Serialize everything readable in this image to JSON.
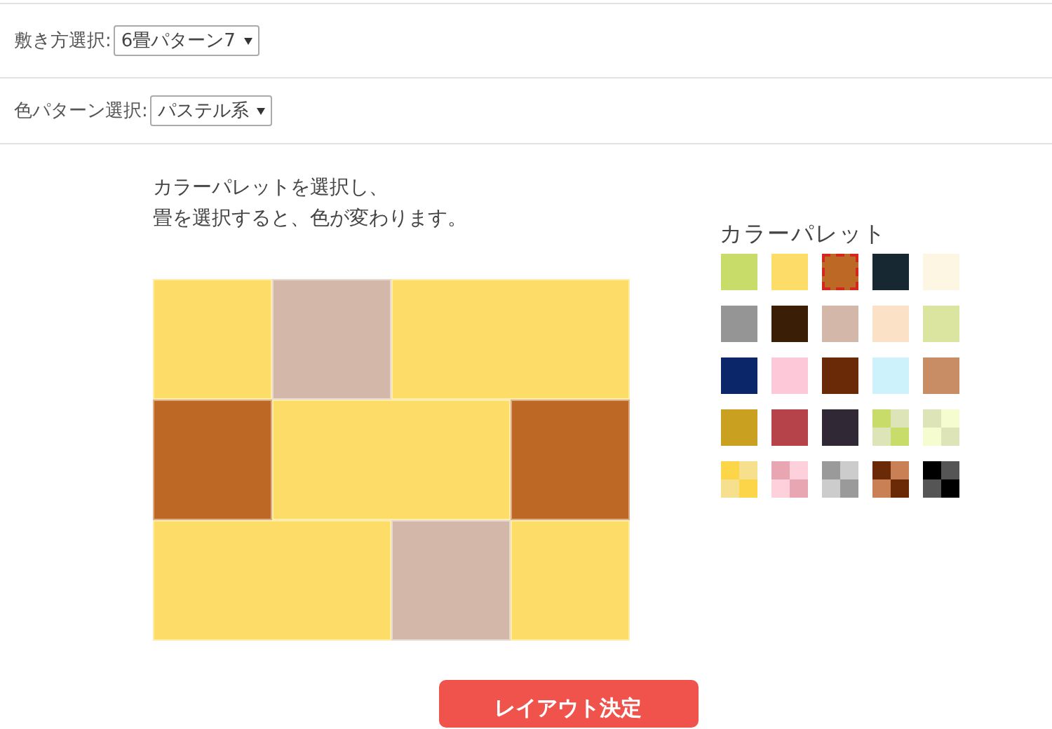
{
  "selectors": [
    {
      "label": "敷き方選択:",
      "value": "6畳パターン7"
    },
    {
      "label": "色パターン選択:",
      "value": "パステル系"
    }
  ],
  "instructions": [
    "カラーパレットを選択し、",
    "畳を選択すると、色が変わります。"
  ],
  "tatami_rows": [
    [
      {
        "kind": "half",
        "color": "#fddd67"
      },
      {
        "kind": "half",
        "color": "#d3b8aa"
      },
      {
        "kind": "full",
        "color": "#fddd67"
      }
    ],
    [
      {
        "kind": "half",
        "color": "#bd6925"
      },
      {
        "kind": "full",
        "color": "#fddd67"
      },
      {
        "kind": "half",
        "color": "#bd6925"
      }
    ],
    [
      {
        "kind": "full",
        "color": "#fddd67"
      },
      {
        "kind": "half",
        "color": "#d3b8aa"
      },
      {
        "kind": "half",
        "color": "#fddd67"
      }
    ]
  ],
  "palette": {
    "title": "カラーパレット",
    "swatches": [
      {
        "kind": "solid",
        "color": "#c8dc6a",
        "selected": false
      },
      {
        "kind": "solid",
        "color": "#fddd67",
        "selected": false
      },
      {
        "kind": "solid",
        "color": "#bd6925",
        "selected": true
      },
      {
        "kind": "solid",
        "color": "#182833",
        "selected": false
      },
      {
        "kind": "solid",
        "color": "#fdf6e3",
        "selected": false
      },
      {
        "kind": "solid",
        "color": "#959595",
        "selected": false
      },
      {
        "kind": "solid",
        "color": "#3a1e05",
        "selected": false
      },
      {
        "kind": "solid",
        "color": "#d3b8aa",
        "selected": false
      },
      {
        "kind": "solid",
        "color": "#fbe1c6",
        "selected": false
      },
      {
        "kind": "solid",
        "color": "#dbe5a0",
        "selected": false
      },
      {
        "kind": "solid",
        "color": "#0b2669",
        "selected": false
      },
      {
        "kind": "solid",
        "color": "#fdc9d8",
        "selected": false
      },
      {
        "kind": "solid",
        "color": "#6a2a08",
        "selected": false
      },
      {
        "kind": "solid",
        "color": "#cdf2fb",
        "selected": false
      },
      {
        "kind": "solid",
        "color": "#c98d66",
        "selected": false
      },
      {
        "kind": "solid",
        "color": "#c9a020",
        "selected": false
      },
      {
        "kind": "solid",
        "color": "#b6424a",
        "selected": false
      },
      {
        "kind": "solid",
        "color": "#302834",
        "selected": false
      },
      {
        "kind": "checker",
        "squares": [
          {
            "color": "#c8dc6a"
          },
          {
            "color": "#dde5b8"
          },
          {
            "color": "#dde5b8"
          },
          {
            "color": "#c8dc6a"
          }
        ],
        "selected": false
      },
      {
        "kind": "checker",
        "squares": [
          {
            "color": "#dde5b8"
          },
          {
            "color": "#f5fcd0"
          },
          {
            "color": "#f5fcd0"
          },
          {
            "color": "#dde5b8"
          }
        ],
        "selected": false
      },
      {
        "kind": "checker",
        "squares": [
          {
            "color": "#fdd549"
          },
          {
            "color": "#f6e08e"
          },
          {
            "color": "#f6e08e"
          },
          {
            "color": "#fdd549"
          }
        ],
        "selected": false
      },
      {
        "kind": "checker",
        "squares": [
          {
            "color": "#e8a5b2"
          },
          {
            "color": "#fdd0dc"
          },
          {
            "color": "#fdd0dc"
          },
          {
            "color": "#e8a5b2"
          }
        ],
        "selected": false
      },
      {
        "kind": "checker",
        "squares": [
          {
            "color": "#9a9a9a"
          },
          {
            "color": "#cccccc"
          },
          {
            "color": "#cccccc"
          },
          {
            "color": "#9a9a9a"
          }
        ],
        "selected": false
      },
      {
        "kind": "checker",
        "squares": [
          {
            "color": "#6a2a08"
          },
          {
            "color": "#c98055"
          },
          {
            "color": "#c98055"
          },
          {
            "color": "#6a2a08"
          }
        ],
        "selected": false
      },
      {
        "kind": "checker",
        "squares": [
          {
            "color": "#000000"
          },
          {
            "color": "#555555"
          },
          {
            "color": "#555555"
          },
          {
            "color": "#000000"
          }
        ],
        "selected": false
      }
    ]
  },
  "submit_button": "レイアウト決定"
}
